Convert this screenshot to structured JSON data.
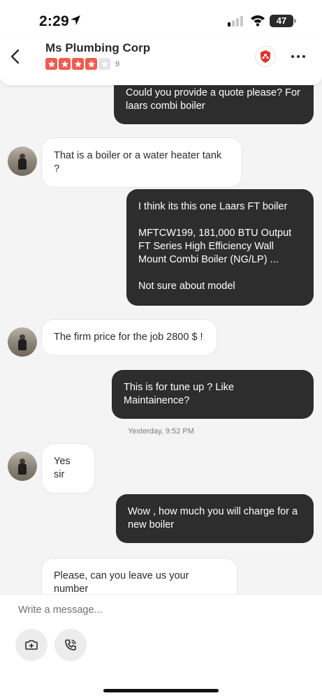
{
  "status_bar": {
    "time": "2:29",
    "battery": "47",
    "icons": [
      "location-arrow-icon",
      "cellular-signal-icon",
      "wifi-icon",
      "battery-icon"
    ]
  },
  "header": {
    "business_name": "Ms Plumbing Corp",
    "rating": 4,
    "rating_max": 5,
    "review_count": "9",
    "icons": [
      "back-chevron-icon",
      "yelp-badge-icon",
      "more-options-icon"
    ]
  },
  "messages": [
    {
      "sender": "me",
      "text": "Could you provide a quote please? For laars combi boiler"
    },
    {
      "sender": "them",
      "text": "That is a boiler or a water heater tank ?"
    },
    {
      "sender": "me",
      "lines": [
        "I think its this one Laars FT boiler",
        "",
        "MFTCW199, 181,000 BTU Output FT Series High Efficiency Wall Mount Combi Boiler (NG/LP) ...",
        "",
        "Not sure about model"
      ]
    },
    {
      "sender": "them",
      "text": "The firm price for the job 2800 $ !"
    },
    {
      "sender": "me",
      "text": "This is for tune up ? Like Maintainence?"
    },
    {
      "sender": "them",
      "text": "Yes sir"
    },
    {
      "sender": "me",
      "text": "Wow , how much you will charge for a new boiler"
    },
    {
      "sender": "them",
      "text": "Please, can you leave us your number"
    }
  ],
  "timestamp": "Yesterday, 9:52 PM",
  "composer": {
    "placeholder": "Write a message...",
    "buttons": [
      "add-photo-button",
      "call-button"
    ]
  },
  "colors": {
    "brand_red": "#f15c4f",
    "my_bubble": "#2d2d2d",
    "their_bubble": "#ffffff",
    "background": "#f4f4f5"
  }
}
